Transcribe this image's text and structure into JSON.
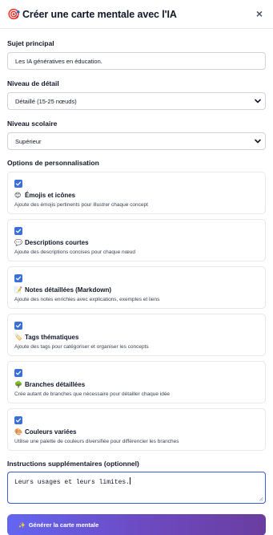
{
  "header": {
    "icon": "🎯",
    "title": "Créer une carte mentale avec l'IA",
    "close": "×"
  },
  "subject": {
    "label": "Sujet principal",
    "value": "Les IA génératives en éducation."
  },
  "detail": {
    "label": "Niveau de détail",
    "value": "Détaillé (15-25 nœuds)"
  },
  "level": {
    "label": "Niveau scolaire",
    "value": "Supérieur"
  },
  "options": {
    "label": "Options de personnalisation",
    "items": [
      {
        "icon": "😊",
        "title": "Émojis et icônes",
        "desc": "Ajoute des émojis pertinents pour illustrer chaque concept",
        "checked": true
      },
      {
        "icon": "💬",
        "title": "Descriptions courtes",
        "desc": "Ajoute des descriptions concises pour chaque nœud",
        "checked": true
      },
      {
        "icon": "📝",
        "title": "Notes détaillées (Markdown)",
        "desc": "Ajoute des notes enrichies avec explications, exemples et liens",
        "checked": true
      },
      {
        "icon": "🏷️",
        "title": "Tags thématiques",
        "desc": "Ajoute des tags pour catégoriser et organiser les concepts",
        "checked": true
      },
      {
        "icon": "🌳",
        "title": "Branches détaillées",
        "desc": "Crée autant de branches que nécessaire pour détailler chaque idée",
        "checked": true
      },
      {
        "icon": "🎨",
        "title": "Couleurs variées",
        "desc": "Utilise une palette de couleurs diversifiée pour différencier les branches",
        "checked": true
      }
    ]
  },
  "instructions": {
    "label": "Instructions supplémentaires (optionnel)",
    "value": "Leurs usages et leurs limites."
  },
  "generate": {
    "icon": "✨",
    "label": "Générer la carte mentale"
  },
  "colors": {
    "accent": "#3b6fd8",
    "button_start": "#6366f1",
    "button_end": "#6a3d9f"
  }
}
